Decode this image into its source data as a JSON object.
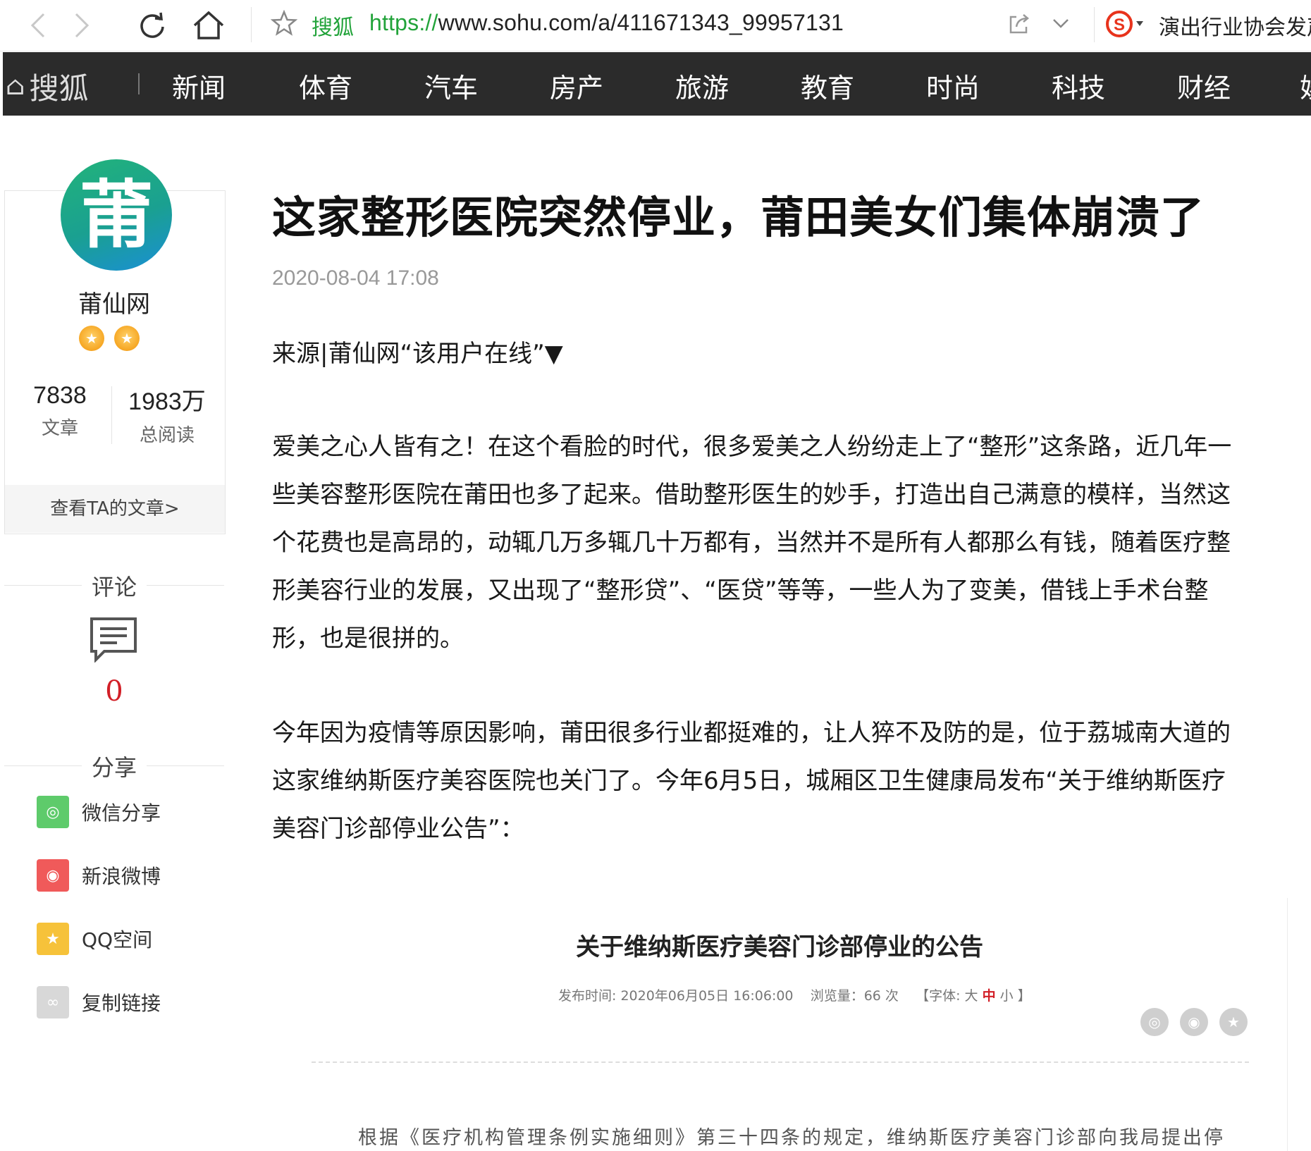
{
  "browser": {
    "site_label": "搜狐",
    "url_protocol": "https://",
    "url_rest": "www.sohu.com/a/411671343_99957131",
    "search_text": "演出行业协会发声"
  },
  "site_nav": {
    "logo_text": "搜狐",
    "items": [
      "新闻",
      "体育",
      "汽车",
      "房产",
      "旅游",
      "教育",
      "时尚",
      "科技",
      "财经",
      "娱"
    ]
  },
  "author": {
    "avatar_char": "莆",
    "name": "莆仙网",
    "articles_count": "7838",
    "articles_label": "文章",
    "reads_count": "1983万",
    "reads_label": "总阅读",
    "view_link": "查看TA的文章>"
  },
  "comment": {
    "title": "评论",
    "count": "0"
  },
  "share": {
    "title": "分享",
    "items": [
      "微信分享",
      "新浪微博",
      "QQ空间",
      "复制链接"
    ]
  },
  "article": {
    "title": "这家整形医院突然停业，莆田美女们集体崩溃了",
    "date": "2020-08-04 17:08",
    "source_line": "来源|莆仙网“该用户在线”▼",
    "para1_lines": [
      "爱美之心人皆有之！在这个看脸的时代，很多爱美之人纷纷走上了“整形”这条路，近几年一",
      "些美容整形医院在莆田也多了起来。借助整形医生的妙手，打造出自己满意的模样，当然这",
      "个花费也是高昂的，动辄几万多辄几十万都有，当然并不是所有人都那么有钱，随着医疗整",
      "形美容行业的发展，又出现了“整形贷”、“医贷”等等，一些人为了变美，借钱上手术台整",
      "形，也是很拼的。"
    ],
    "para2_lines": [
      "今年因为疫情等原因影响，莆田很多行业都挺难的，让人猝不及防的是，位于荔城南大道的",
      "这家维纳斯医疗美容医院也关门了。今年6月5日，城厢区卫生健康局发布“关于维纳斯医疗",
      "美容门诊部停业公告”："
    ]
  },
  "notice": {
    "title": "关于维纳斯医疗美容门诊部停业的公告",
    "meta_publish": "发布时间: 2020年06月05日 16:06:00",
    "meta_views": "浏览量：66 次",
    "meta_font_prefix": "【字体:",
    "font_large": "大",
    "font_medium": "中",
    "font_small": "小",
    "meta_font_suffix": "】",
    "body": "根据《医疗机构管理条例实施细则》第三十四条的规定，维纳斯医疗美容门诊部向我局提出停"
  },
  "colors": {
    "nav_bg": "#2b2b2b",
    "accent_green": "#22a33a",
    "comment_red": "#d21f27"
  }
}
